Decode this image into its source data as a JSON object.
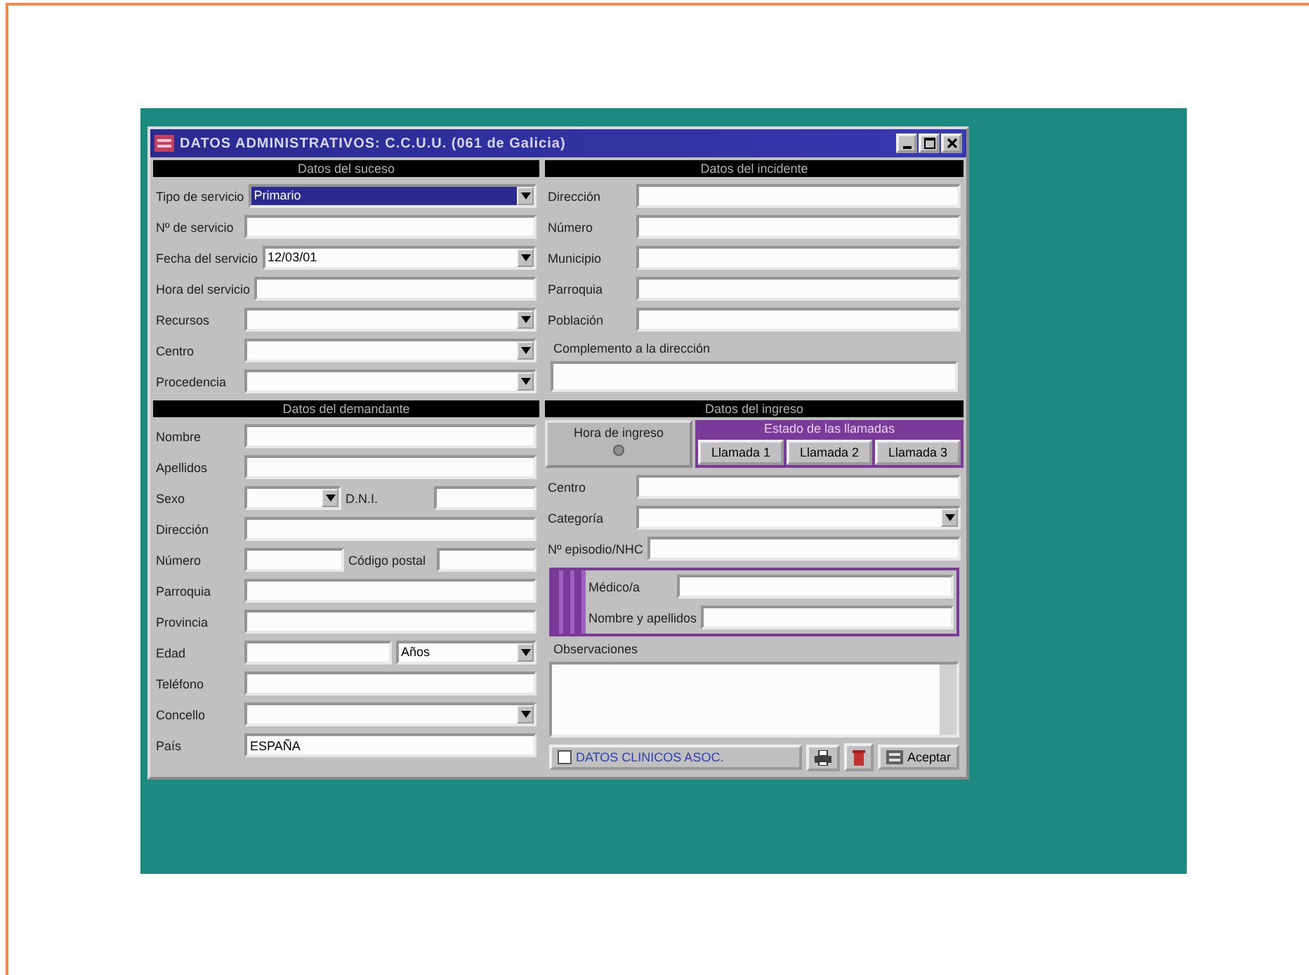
{
  "window": {
    "title": "DATOS ADMINISTRATIVOS: C.C.U.U. (061 de Galicia)"
  },
  "suceso": {
    "heading": "Datos del suceso",
    "rows": [
      {
        "cells": [
          {
            "kind": "label",
            "text": "Tipo de servicio"
          },
          {
            "kind": "select",
            "value": "Primario",
            "focused": true
          }
        ]
      },
      {
        "cells": [
          {
            "kind": "label",
            "text": "Nº de servicio"
          },
          {
            "kind": "input"
          }
        ]
      },
      {
        "cells": [
          {
            "kind": "label",
            "text": "Fecha del servicio"
          },
          {
            "kind": "select",
            "value": "12/03/01",
            "focused": false
          }
        ]
      },
      {
        "cells": [
          {
            "kind": "label",
            "text": "Hora del servicio"
          },
          {
            "kind": "input"
          }
        ]
      },
      {
        "cells": [
          {
            "kind": "label",
            "text": "Recursos"
          },
          {
            "kind": "select",
            "focused": false
          }
        ]
      },
      {
        "cells": [
          {
            "kind": "label",
            "text": "Centro"
          },
          {
            "kind": "select",
            "focused": false
          }
        ]
      },
      {
        "cells": [
          {
            "kind": "label",
            "text": "Procedencia"
          },
          {
            "kind": "select",
            "focused": false
          }
        ]
      }
    ]
  },
  "incidente": {
    "heading": "Datos del incidente",
    "rows": [
      {
        "cells": [
          {
            "kind": "label",
            "text": "Dirección"
          },
          {
            "kind": "input"
          }
        ]
      },
      {
        "cells": [
          {
            "kind": "label",
            "text": "Número"
          },
          {
            "kind": "input"
          }
        ]
      },
      {
        "cells": [
          {
            "kind": "label",
            "text": "Municipio"
          },
          {
            "kind": "input"
          }
        ]
      },
      {
        "cells": [
          {
            "kind": "label",
            "text": "Parroquia"
          },
          {
            "kind": "input"
          }
        ]
      },
      {
        "cells": [
          {
            "kind": "label",
            "text": "Población"
          },
          {
            "kind": "input"
          }
        ]
      }
    ],
    "complement_label": "Complemento a la dirección"
  },
  "demandante": {
    "heading": "Datos del demandante",
    "rows": [
      {
        "cells": [
          {
            "kind": "label",
            "text": "Nombre"
          },
          {
            "kind": "input"
          }
        ]
      },
      {
        "cells": [
          {
            "kind": "label",
            "text": "Apellidos"
          },
          {
            "kind": "input"
          }
        ]
      },
      {
        "cells": [
          {
            "kind": "label",
            "text": "Sexo"
          },
          {
            "kind": "select",
            "focused": false
          },
          {
            "kind": "label",
            "text": "D.N.I."
          },
          {
            "kind": "input"
          }
        ]
      },
      {
        "cells": [
          {
            "kind": "label",
            "text": "Dirección"
          },
          {
            "kind": "input"
          }
        ]
      },
      {
        "cells": [
          {
            "kind": "label",
            "text": "Número"
          },
          {
            "kind": "input"
          },
          {
            "kind": "label",
            "text": "Código postal"
          },
          {
            "kind": "input"
          }
        ]
      },
      {
        "cells": [
          {
            "kind": "label",
            "text": "Parroquia"
          },
          {
            "kind": "input"
          }
        ]
      },
      {
        "cells": [
          {
            "kind": "label",
            "text": "Provincia"
          },
          {
            "kind": "input"
          }
        ]
      },
      {
        "cells": [
          {
            "kind": "label",
            "text": "Edad"
          },
          {
            "kind": "input"
          },
          {
            "kind": "select",
            "value": "Años",
            "focused": false
          }
        ]
      },
      {
        "cells": [
          {
            "kind": "label",
            "text": "Teléfono"
          },
          {
            "kind": "input"
          }
        ]
      },
      {
        "cells": [
          {
            "kind": "label",
            "text": "Concello"
          },
          {
            "kind": "select",
            "focused": false
          }
        ]
      },
      {
        "cells": [
          {
            "kind": "label",
            "text": "País"
          },
          {
            "kind": "input",
            "value": "ESPAÑA"
          }
        ]
      }
    ]
  },
  "ingreso": {
    "heading": "Datos del ingreso",
    "arrival_label": "Hora de ingreso",
    "calls_heading": "Estado de las llamadas",
    "calls": [
      "Llamada 1",
      "Llamada 2",
      "Llamada 3"
    ],
    "rows": [
      {
        "cells": [
          {
            "kind": "label",
            "text": "Centro"
          },
          {
            "kind": "input"
          }
        ]
      },
      {
        "cells": [
          {
            "kind": "label",
            "text": "Categoría"
          },
          {
            "kind": "select",
            "focused": false
          }
        ]
      },
      {
        "cells": [
          {
            "kind": "label",
            "text": "Nº episodio/NHC"
          },
          {
            "kind": "input"
          }
        ]
      }
    ],
    "staff_rows": [
      {
        "cells": [
          {
            "kind": "label",
            "text": "Médico/a"
          },
          {
            "kind": "input"
          }
        ]
      },
      {
        "cells": [
          {
            "kind": "label",
            "text": "Nombre y apellidos"
          },
          {
            "kind": "input"
          }
        ]
      }
    ],
    "notes_label": "Observaciones"
  },
  "footer": {
    "clinical_button": "DATOS CLINICOS ASOC.",
    "clinical_checked": false,
    "accept_button": "Aceptar"
  }
}
